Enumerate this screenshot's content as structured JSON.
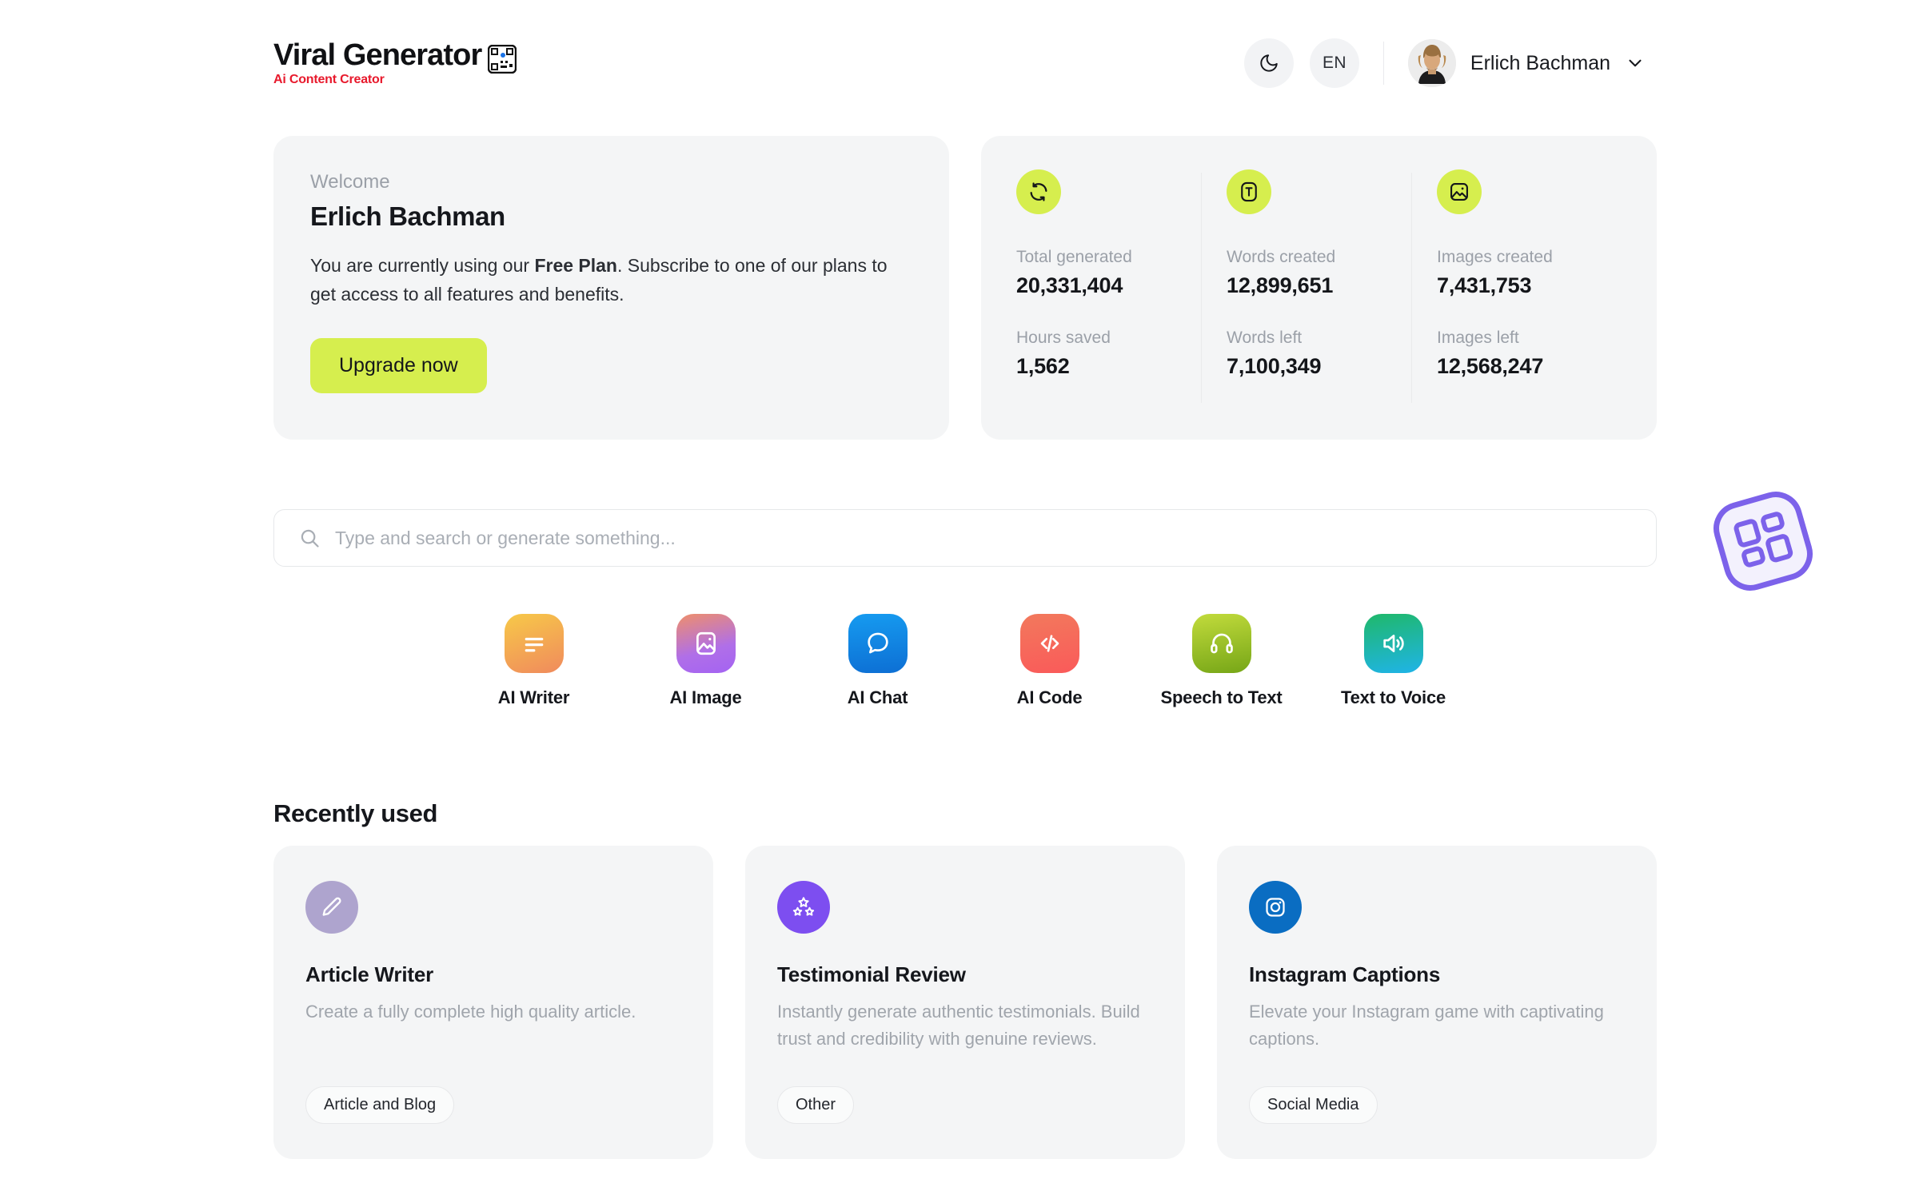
{
  "brand": {
    "title": "Viral Generator",
    "tagline": "Ai Content Creator",
    "logo_icon": "qr-code-icon"
  },
  "header": {
    "theme_toggle": {
      "icon": "moon-icon",
      "label": ""
    },
    "language": {
      "label": "EN",
      "icon": "language-button"
    },
    "user": {
      "name": "Erlich Bachman",
      "avatar": "user-avatar",
      "chevron": "chevron-down-icon"
    }
  },
  "welcome": {
    "label": "Welcome",
    "name": "Erlich Bachman",
    "desc_before": "You are currently using our ",
    "plan": "Free Plan",
    "desc_after": ". Subscribe to one of our plans to get access to all features and benefits.",
    "cta": "Upgrade now",
    "cta_color": "#d6ee4e"
  },
  "stats": {
    "columns": [
      {
        "icon": "refresh-cycle-icon",
        "top_label": "Total generated",
        "top_value": "20,331,404",
        "bottom_label": "Hours saved",
        "bottom_value": "1,562"
      },
      {
        "icon": "text-box-icon",
        "top_label": "Words created",
        "top_value": "12,899,651",
        "bottom_label": "Words left",
        "bottom_value": "7,100,349"
      },
      {
        "icon": "image-icon",
        "top_label": "Images created",
        "top_value": "7,431,753",
        "bottom_label": "Images left",
        "bottom_value": "12,568,247"
      }
    ],
    "badge_color": "#d6ee4e"
  },
  "search": {
    "placeholder": "Type and search or generate something...",
    "value": "",
    "icon": "search-icon"
  },
  "tools": [
    {
      "label": "AI Writer",
      "icon": "lines-icon",
      "color_from": "#f7c948",
      "color_to": "#f08a5d"
    },
    {
      "label": "AI Image",
      "icon": "image-icon",
      "color_from": "#ef8f6a",
      "color_to": "#a463f2"
    },
    {
      "label": "AI Chat",
      "icon": "chat-bubble-icon",
      "color_from": "#169bf0",
      "color_to": "#0d6fd4"
    },
    {
      "label": "AI Code",
      "icon": "code-icon",
      "color_from": "#f2795c",
      "color_to": "#fa5a5a"
    },
    {
      "label": "Speech to Text",
      "icon": "headphones-icon",
      "color_from": "#b9d63a",
      "color_to": "#79a81a"
    },
    {
      "label": "Text to Voice",
      "icon": "speaker-icon",
      "color_from": "#1fb86a",
      "color_to": "#1fb4e8"
    }
  ],
  "floating_widget": {
    "icon": "grid-apps-icon",
    "color": "#7c62ea"
  },
  "recent": {
    "title": "Recently used",
    "cards": [
      {
        "title": "Article Writer",
        "desc": "Create a fully complete high quality article.",
        "tag": "Article and Blog",
        "icon": "pencil-icon",
        "icon_color": "#aea4ce"
      },
      {
        "title": "Testimonial Review",
        "desc": "Instantly generate authentic testimonials. Build trust and credibility with genuine reviews.",
        "tag": "Other",
        "icon": "three-stars-icon",
        "icon_color": "#7d4ef0"
      },
      {
        "title": "Instagram Captions",
        "desc": "Elevate your Instagram game with captivating captions.",
        "tag": "Social Media",
        "icon": "instagram-icon",
        "icon_color": "#0a6dc2"
      }
    ]
  }
}
